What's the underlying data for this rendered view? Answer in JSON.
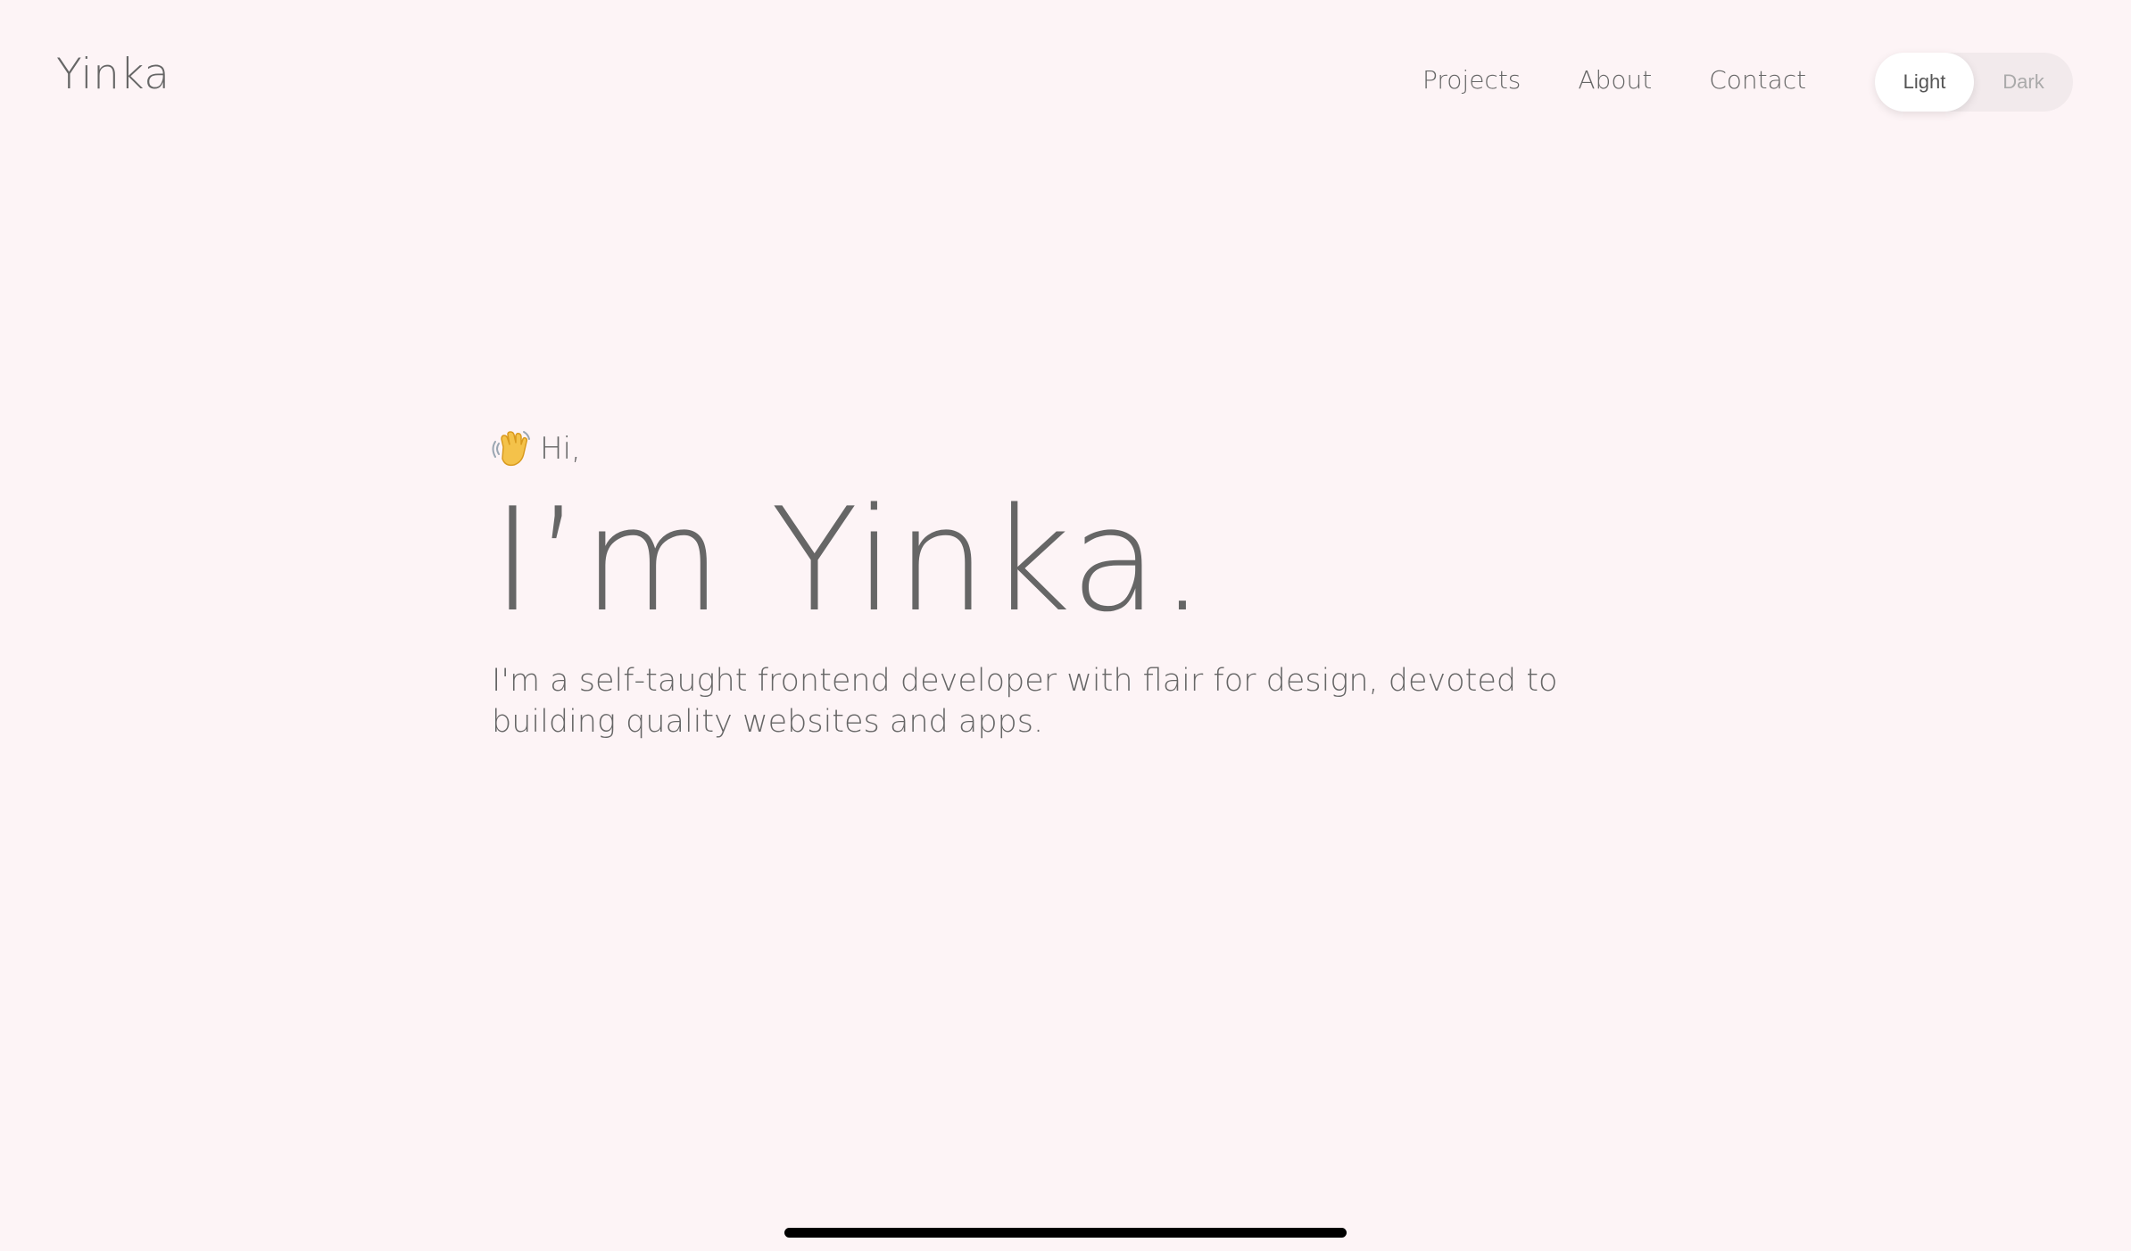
{
  "header": {
    "logo": "Yinka",
    "nav": [
      {
        "label": "Projects"
      },
      {
        "label": "About"
      },
      {
        "label": "Contact"
      }
    ],
    "theme_toggle": {
      "options": [
        "Light",
        "Dark"
      ],
      "selected": "Light"
    }
  },
  "hero": {
    "greeting_icon": "waving-hand-icon",
    "greeting": "Hi,",
    "headline": "I’m Yinka.",
    "subtitle": "I'm a self-taught frontend developer with flair for design, devoted to building quality websites and apps."
  },
  "colors": {
    "background": "#fdf4f6",
    "text": "#666666",
    "toggle_track": "#f2eaec",
    "toggle_active": "#ffffff"
  }
}
